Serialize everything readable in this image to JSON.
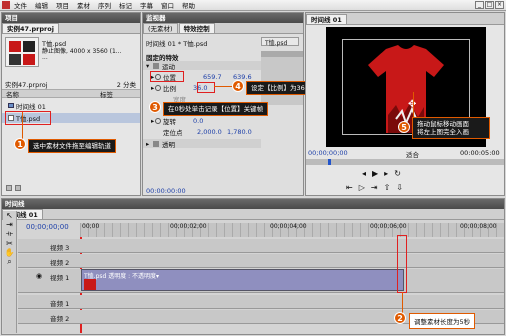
{
  "menubar": {
    "items": [
      "文件",
      "编辑",
      "项目",
      "素材",
      "序列",
      "标记",
      "字幕",
      "窗口",
      "帮助"
    ],
    "win_buttons": [
      "_",
      "□",
      "×"
    ]
  },
  "project": {
    "panel_title": "项目",
    "tab": "实例47.prproj",
    "clip_name": "T恤.psd",
    "clip_type": "静止图像, 4000 x 3560 (1...",
    "clip_extra": "...",
    "folder": "实例47.prproj",
    "items_count": "2 分类",
    "col_name": "名称",
    "col_label": "标签",
    "rows": [
      {
        "name": "时间线 01"
      },
      {
        "name": "T恤.psd"
      }
    ]
  },
  "effects": {
    "panel_title": "监视器",
    "tabs": [
      "(无素材)",
      "特效控制"
    ],
    "sequence_label": "时间线 01 * T恤.psd",
    "clip_label": "T恤.psd",
    "fixed_effects": "固定的特效",
    "motion": "运动",
    "position_label": "位置",
    "position_x": "659.7",
    "position_y": "639.6",
    "scale_label": "比例",
    "scale_value": "36.0",
    "scale_width": "宽度",
    "uniform_scale": "等比",
    "rotation_label": "旋转",
    "rotation_value": "0.0",
    "anchor_label": "定位点",
    "anchor_x": "2,000.0",
    "anchor_y": "1,780.0",
    "opacity_label": "透明",
    "timecode": "00:00:00:00"
  },
  "program": {
    "tab": "时间线 01",
    "timecode_left": "00;00;00;00",
    "fit": "适合",
    "timecode_right": "00:00:05:00"
  },
  "timeline": {
    "panel_title": "时间线",
    "tab": "时间线 01",
    "timecode": "00;00;00;00",
    "ruler_labels": [
      "00;00",
      "00;00;02;00",
      "00;00;04;00",
      "00;00;06;00",
      "00;00;08;00"
    ],
    "tracks": [
      "视频 3",
      "视频 2",
      "视频 1",
      "音频 1",
      "音频 2"
    ],
    "clip_label": "T恤.psd 透明度 : 不透明度▾"
  },
  "callouts": [
    {
      "num": "1",
      "text": "选中素材文件拖至编辑轨道"
    },
    {
      "num": "2",
      "text": "调整素材长度为5秒"
    },
    {
      "num": "3",
      "text": "在0秒处单击记录【位置】关键帧"
    },
    {
      "num": "4",
      "text": "设定【比例】为36"
    },
    {
      "num": "5",
      "text": "拖动鼠标移动画面\n将左上图完全入画"
    }
  ],
  "colors": {
    "callout": "#e05a00",
    "shirt": "#c81818"
  }
}
